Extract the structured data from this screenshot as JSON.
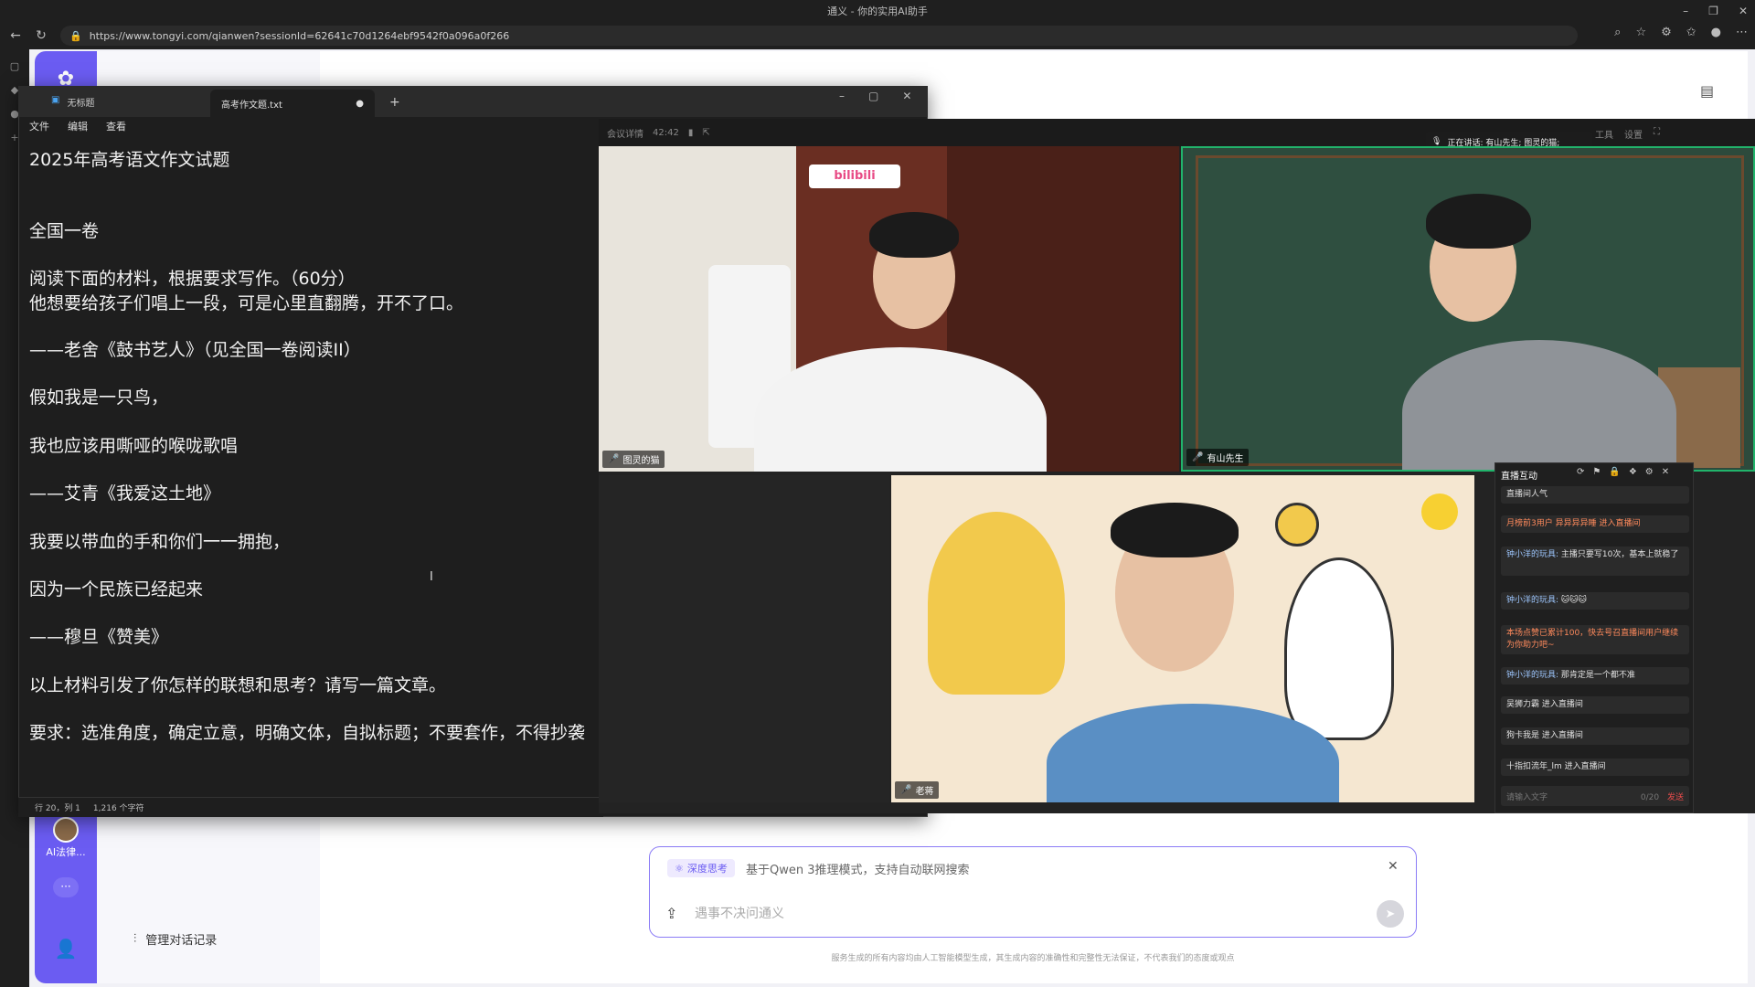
{
  "browser": {
    "title": "通义 - 你的实用AI助手",
    "url": "https://www.tongyi.com/qianwen?sessionId=62641c70d1264ebf9542f0a096a0f266"
  },
  "app": {
    "rail_avatar_label": "AI法律...",
    "manage_history": "管理对话记录",
    "chat": {
      "deep_think_label": "深度思考",
      "deep_think_desc": "基于Qwen 3推理模式，支持自动联网搜索",
      "input_placeholder": "遇事不决问通义",
      "disclaimer": "服务生成的所有内容均由人工智能模型生成，其生成内容的准确性和完整性无法保证，不代表我们的态度或观点"
    }
  },
  "notepad": {
    "tab_untitled": "无标题",
    "tab_active": "高考作文题.txt",
    "menu": [
      "文件",
      "编辑",
      "查看"
    ],
    "lines": [
      "2025年高考语文作文试题",
      "",
      "全国一卷",
      "",
      "阅读下面的材料，根据要求写作。（60分）",
      "他想要给孩子们唱上一段，可是心里直翻腾，开不了口。",
      "",
      "——老舍《鼓书艺人》（见全国一卷阅读II）",
      "",
      "假如我是一只鸟，",
      "",
      "我也应该用嘶哑的喉咙歌唱",
      "",
      "——艾青《我爱这土地》",
      "",
      "我要以带血的手和你们一一拥抱，",
      "",
      "因为一个民族已经起来",
      "",
      "——穆旦《赞美》",
      "",
      "以上材料引发了你怎样的联想和思考？请写一篇文章。",
      "",
      "要求：选准角度，确定立意，明确文体，自拟标题；不要套作，不得抄袭"
    ],
    "status_position": "行 20，列 1",
    "status_chars": "1,216 个字符"
  },
  "meeting": {
    "topbar_left": "会议详情",
    "topbar_time": "42:42",
    "speaking": "正在讲话: 有山先生; 图灵的猫;",
    "topbar_right": [
      "工具",
      "设置"
    ],
    "participants": [
      {
        "name": "图灵的猫"
      },
      {
        "name": "有山先生"
      },
      {
        "name": "老蒋"
      }
    ],
    "live": {
      "title": "直播互动",
      "messages": [
        {
          "text": "直播间人气",
          "style": "plain"
        },
        {
          "text": "月榜前3用户 异异异异睡 进入直播间",
          "style": "orange"
        },
        {
          "name": "钟小洋的玩具:",
          "text": " 主播只要写10次，基本上就稳了",
          "style": "chat"
        },
        {
          "name": "钟小洋的玩具:",
          "text": " 🐱🐱🐱",
          "style": "chat"
        },
        {
          "text": "本场点赞已累计100，快去号召直播间用户继续为你助力吧~",
          "style": "orange"
        },
        {
          "name": "钟小洋的玩具:",
          "text": " 那肯定是一个都不准",
          "style": "chat"
        },
        {
          "text": "吴狮力霸 进入直播间",
          "style": "plain"
        },
        {
          "text": "狗卡我是 进入直播间",
          "style": "plain"
        },
        {
          "text": "十指扣流年_lm 进入直播间",
          "style": "plain"
        }
      ],
      "input_placeholder": "请输入文字",
      "input_count": "0/20",
      "send": "发送"
    }
  }
}
